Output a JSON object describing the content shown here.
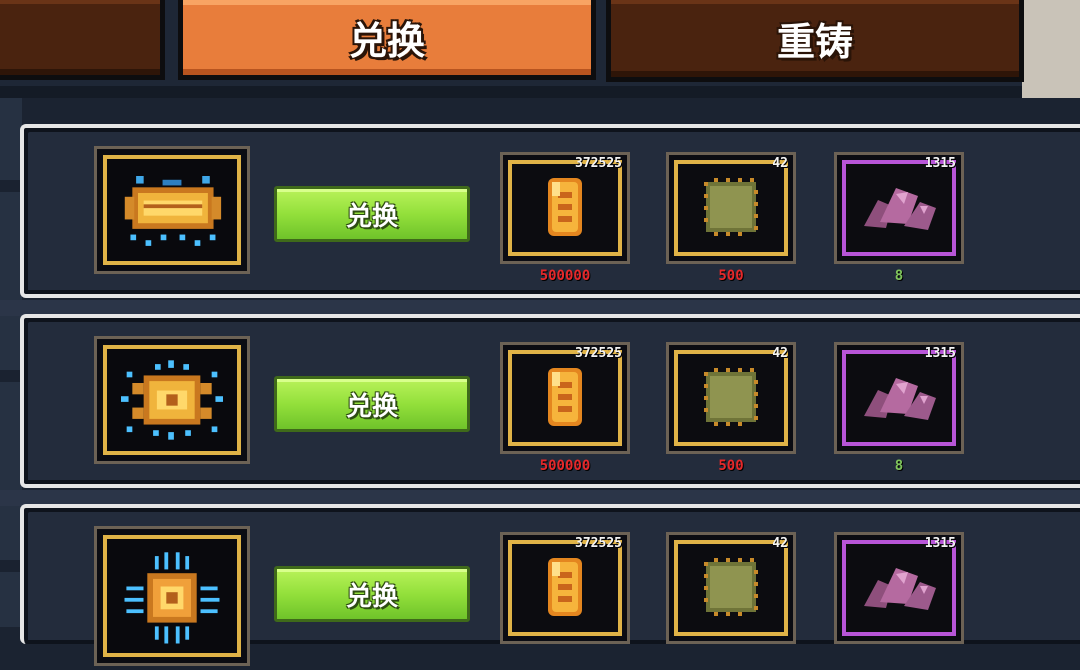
{
  "tabs": {
    "left_fragment": "",
    "exchange": "兑换",
    "recast": "重铸"
  },
  "colors": {
    "need_insufficient": "#e5282a",
    "need_sufficient": "#7fc45b",
    "active_tab": "#e87d3b",
    "button_green": "#93e03b"
  },
  "rows": [
    {
      "equip_icon": "equipment-relic-1-icon",
      "button": "兑换",
      "costs": [
        {
          "icon": "amber-gem-icon",
          "owned": "372525",
          "need": "500000"
        },
        {
          "icon": "cloth-patch-icon",
          "owned": "42",
          "need": "500"
        },
        {
          "icon": "purple-ore-icon",
          "owned": "1315",
          "need": "8"
        }
      ]
    },
    {
      "equip_icon": "equipment-relic-2-icon",
      "button": "兑换",
      "costs": [
        {
          "icon": "amber-gem-icon",
          "owned": "372525",
          "need": "500000"
        },
        {
          "icon": "cloth-patch-icon",
          "owned": "42",
          "need": "500"
        },
        {
          "icon": "purple-ore-icon",
          "owned": "1315",
          "need": "8"
        }
      ]
    },
    {
      "equip_icon": "equipment-relic-3-icon",
      "button": "兑换",
      "costs": [
        {
          "icon": "amber-gem-icon",
          "owned": "372525",
          "need": ""
        },
        {
          "icon": "cloth-patch-icon",
          "owned": "42",
          "need": ""
        },
        {
          "icon": "purple-ore-icon",
          "owned": "1315",
          "need": ""
        }
      ]
    }
  ]
}
